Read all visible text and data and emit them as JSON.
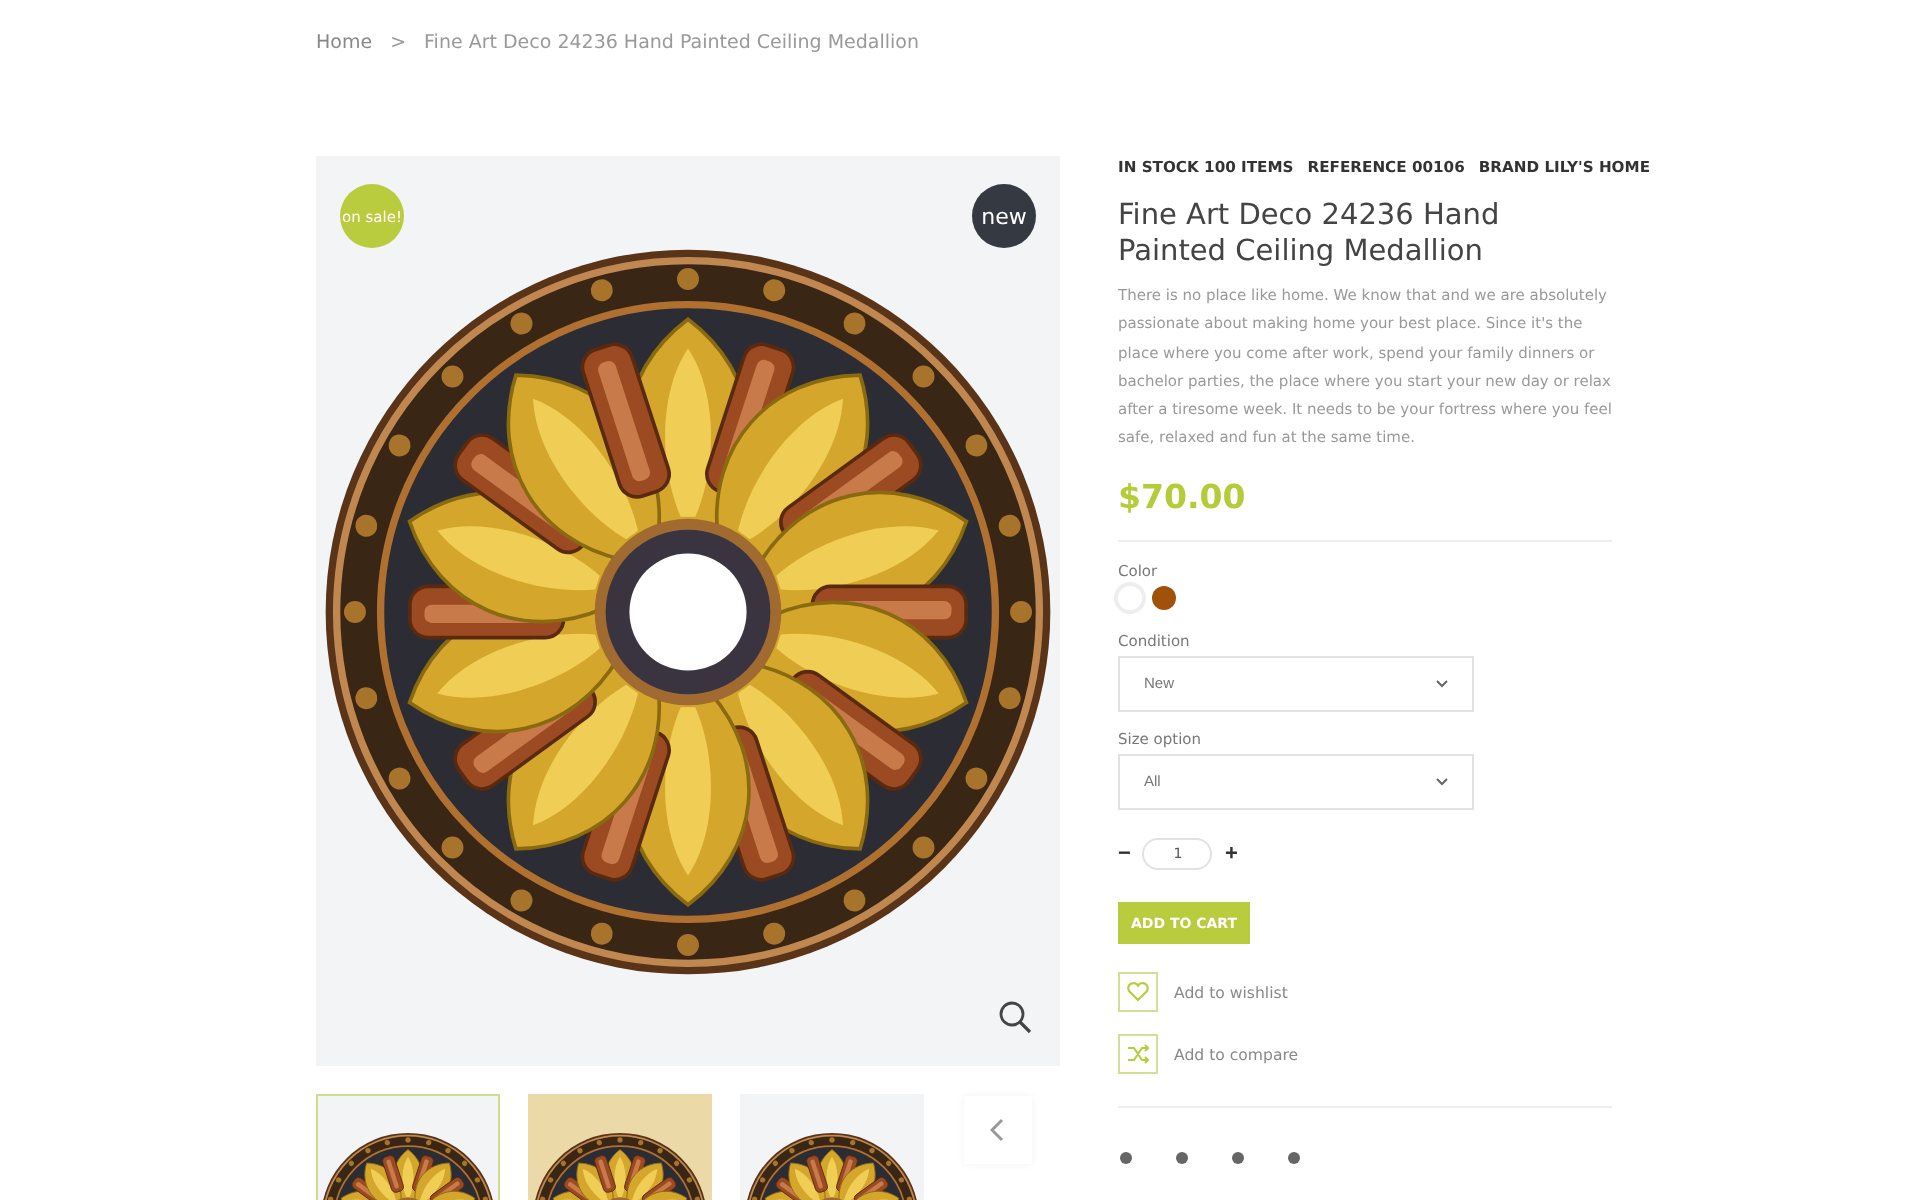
{
  "breadcrumb": {
    "items": [
      "Home",
      "Fine Art Deco 24236 Hand Painted Ceiling Medallion"
    ],
    "separator": ">"
  },
  "gallery": {
    "badges": [
      {
        "kind": "sale",
        "label": "on sale!"
      },
      {
        "kind": "new",
        "label": "new"
      }
    ],
    "thumbnails": [
      {
        "selected": true
      },
      {
        "selected": false
      },
      {
        "selected": false
      }
    ]
  },
  "product": {
    "meta": [
      "IN STOCK 100 ITEMS",
      "REFERENCE 00106",
      "BRAND LILY'S HOME"
    ],
    "title": "Fine Art Deco 24236 Hand Painted Ceiling Medallion",
    "description": "There is no place like home. We know that and we are absolutely passionate about making home your best place. Since it's the place where you come after work, spend your family dinners or bachelor parties, the place where you start your new day or relax after a tiresome week. It needs to be your fortress where you feel safe, relaxed and fun at the same time.",
    "price": "$70.00",
    "color_label": "Color",
    "swatches": [
      {
        "color": "#ffffff",
        "selected": true
      },
      {
        "color": "#a0520a",
        "selected": false
      }
    ],
    "selects": [
      {
        "label": "Condition",
        "value": "New"
      },
      {
        "label": "Size option",
        "value": "All"
      }
    ],
    "quantity": {
      "minus": "−",
      "value": "1",
      "plus": "+"
    },
    "add_to_cart": "ADD TO CART",
    "actions": [
      {
        "kind": "wishlist",
        "label": "Add to wishlist"
      },
      {
        "kind": "compare",
        "label": "Add to compare"
      }
    ]
  }
}
